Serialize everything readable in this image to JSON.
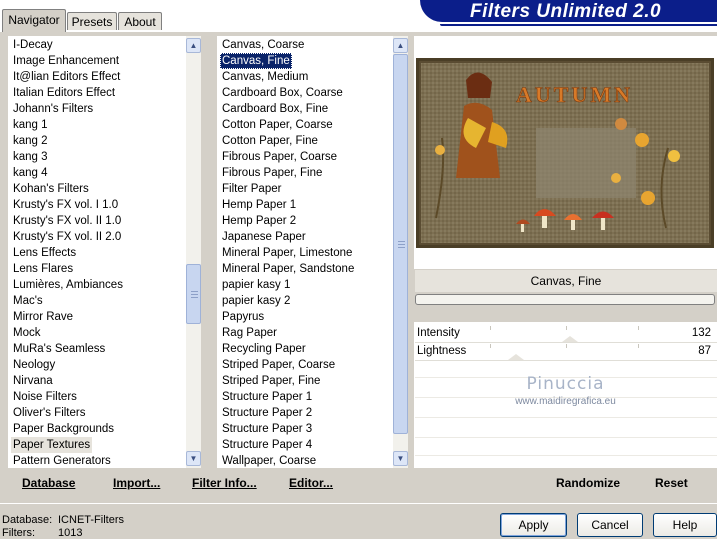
{
  "tabs": [
    {
      "label": "Navigator",
      "active": true
    },
    {
      "label": "Presets",
      "active": false
    },
    {
      "label": "About",
      "active": false
    }
  ],
  "brand": {
    "title": "Filters Unlimited 2.0",
    "color": "#0b1e8a"
  },
  "categories": {
    "items": [
      "I-Decay",
      "Image Enhancement",
      "It@lian Editors Effect",
      "Italian Editors Effect",
      "Johann's Filters",
      "kang 1",
      "kang 2",
      "kang 3",
      "kang 4",
      "Kohan's Filters",
      "Krusty's FX vol. I 1.0",
      "Krusty's FX vol. II 1.0",
      "Krusty's FX vol. II 2.0",
      "Lens Effects",
      "Lens Flares",
      "Lumières, Ambiances",
      "Mac's",
      "Mirror Rave",
      "Mock",
      "MuRa's Seamless",
      "Neology",
      "Nirvana",
      "Noise Filters",
      "Oliver's Filters",
      "Paper Backgrounds",
      "Paper Textures",
      "Pattern Generators"
    ],
    "selected": "Paper Textures"
  },
  "filters": {
    "items": [
      "Canvas, Coarse",
      "Canvas, Fine",
      "Canvas, Medium",
      "Cardboard Box, Coarse",
      "Cardboard Box, Fine",
      "Cotton Paper, Coarse",
      "Cotton Paper, Fine",
      "Fibrous Paper, Coarse",
      "Fibrous Paper, Fine",
      "Filter Paper",
      "Hemp Paper 1",
      "Hemp Paper 2",
      "Japanese Paper",
      "Mineral Paper, Limestone",
      "Mineral Paper, Sandstone",
      "papier kasy 1",
      "papier kasy 2",
      "Papyrus",
      "Rag Paper",
      "Recycling Paper",
      "Striped Paper, Coarse",
      "Striped Paper, Fine",
      "Structure Paper 1",
      "Structure Paper 2",
      "Structure Paper 3",
      "Structure Paper 4",
      "Wallpaper, Coarse"
    ],
    "selected": "Canvas, Fine"
  },
  "toolbar": {
    "database": "Database",
    "import": "Import...",
    "filter_info": "Filter Info...",
    "editor": "Editor..."
  },
  "preview": {
    "artwork_title": "AUTUMN",
    "watermark_line1": "Pinuccia",
    "watermark_line2": "www.maidiregrafica.eu"
  },
  "filter_name": "Canvas, Fine",
  "params": [
    {
      "label": "Intensity",
      "value": "132"
    },
    {
      "label": "Lightness",
      "value": "87"
    }
  ],
  "right_buttons": {
    "randomize": "Randomize",
    "reset": "Reset"
  },
  "status": {
    "database_label": "Database:",
    "database_value": "ICNET-Filters",
    "filters_label": "Filters:",
    "filters_value": "1013"
  },
  "dialog_buttons": {
    "apply": "Apply",
    "cancel": "Cancel",
    "help": "Help"
  }
}
